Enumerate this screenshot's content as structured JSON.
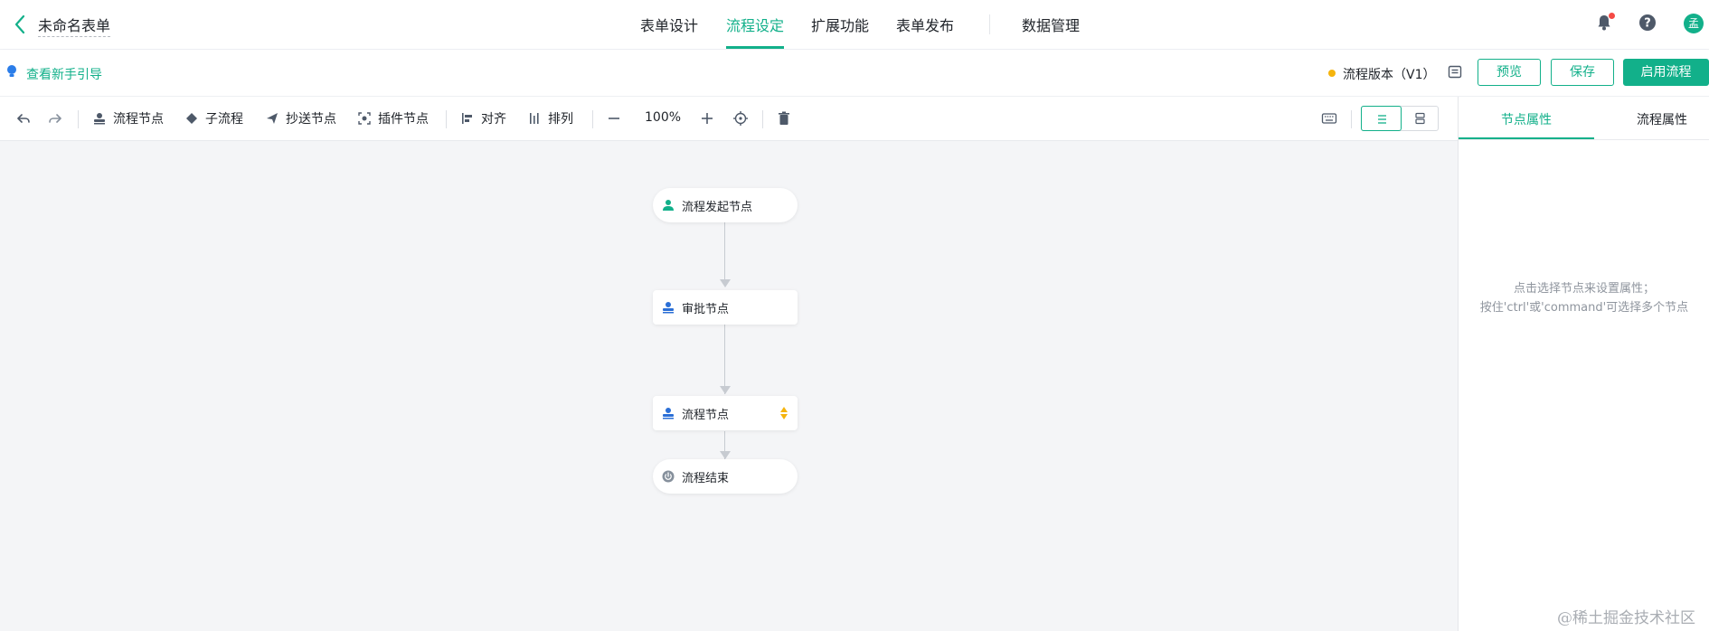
{
  "header": {
    "form_name": "未命名表单",
    "tabs": [
      {
        "label": "表单设计",
        "active": false
      },
      {
        "label": "流程设定",
        "active": true
      },
      {
        "label": "扩展功能",
        "active": false
      },
      {
        "label": "表单发布",
        "active": false
      },
      {
        "label": "数据管理",
        "active": false
      }
    ],
    "avatar_text": "孟",
    "icons": [
      "bell-icon",
      "help-icon"
    ]
  },
  "subbar": {
    "guide_link": "查看新手引导",
    "version_label": "流程版本（V1）",
    "buttons": {
      "preview": "预览",
      "save": "保存",
      "enable": "启用流程"
    }
  },
  "toolbar": {
    "flow_node": "流程节点",
    "sub_flow": "子流程",
    "cc_node": "抄送节点",
    "plugin_node": "插件节点",
    "align": "对齐",
    "arrange": "排列",
    "zoom": "100%"
  },
  "canvas": {
    "nodes": [
      {
        "label": "流程发起节点",
        "type": "start"
      },
      {
        "label": "审批节点",
        "type": "approval"
      },
      {
        "label": "流程节点",
        "type": "flow"
      },
      {
        "label": "流程结束",
        "type": "end"
      }
    ],
    "watermark": "@稀土掘金技术社区"
  },
  "panel": {
    "tabs": [
      {
        "label": "节点属性",
        "active": true
      },
      {
        "label": "流程属性",
        "active": false
      }
    ],
    "hint_line1": "点击选择节点来设置属性；",
    "hint_line2": "按住'ctrl'或'command'可选择多个节点"
  },
  "colors": {
    "accent": "#12b08a",
    "version_dot": "#f5b40d",
    "notification_dot": "#f54a45",
    "canvas_bg": "#f4f5f7"
  }
}
